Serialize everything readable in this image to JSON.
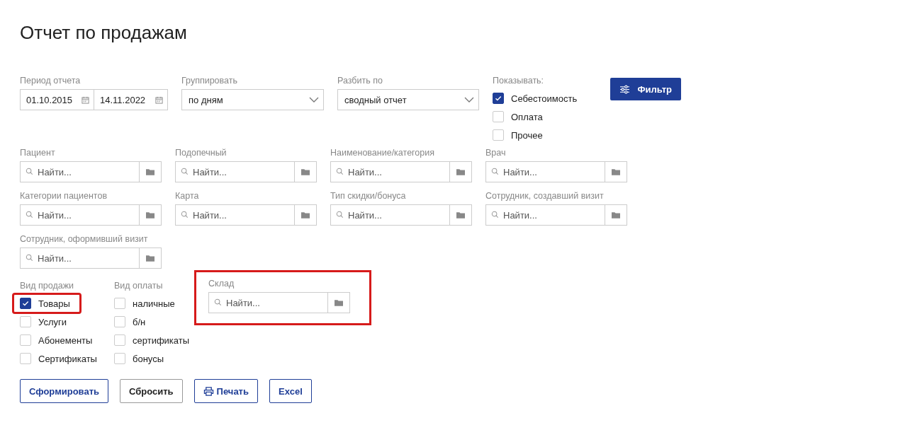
{
  "title": "Отчет по продажам",
  "period": {
    "label": "Период отчета",
    "from": "01.10.2015",
    "to": "14.11.2022"
  },
  "group_by": {
    "label": "Группировать",
    "value": "по дням"
  },
  "split_by": {
    "label": "Разбить по",
    "value": "сводный отчет"
  },
  "show": {
    "label": "Показывать:",
    "options": [
      {
        "label": "Себестоимость",
        "checked": true
      },
      {
        "label": "Оплата",
        "checked": false
      },
      {
        "label": "Прочее",
        "checked": false
      }
    ]
  },
  "filter_button": "Фильтр",
  "lookups": [
    {
      "label": "Пациент",
      "placeholder": "Найти..."
    },
    {
      "label": "Подопечный",
      "placeholder": "Найти..."
    },
    {
      "label": "Наименование/категория",
      "placeholder": "Найти..."
    },
    {
      "label": "Врач",
      "placeholder": "Найти..."
    },
    {
      "label": "Категории пациентов",
      "placeholder": "Найти..."
    },
    {
      "label": "Карта",
      "placeholder": "Найти..."
    },
    {
      "label": "Тип скидки/бонуса",
      "placeholder": "Найти..."
    },
    {
      "label": "Сотрудник, создавший визит",
      "placeholder": "Найти..."
    },
    {
      "label": "Сотрудник, оформивший визит",
      "placeholder": "Найти..."
    }
  ],
  "sale_type": {
    "label": "Вид продажи",
    "options": [
      {
        "label": "Товары",
        "checked": true,
        "highlighted": true
      },
      {
        "label": "Услуги",
        "checked": false,
        "highlighted": false
      },
      {
        "label": "Абонементы",
        "checked": false,
        "highlighted": false
      },
      {
        "label": "Сертификаты",
        "checked": false,
        "highlighted": false
      }
    ]
  },
  "payment_type": {
    "label": "Вид оплаты",
    "options": [
      {
        "label": "наличные",
        "checked": false,
        "highlighted": false
      },
      {
        "label": "б/н",
        "checked": false,
        "highlighted": false
      },
      {
        "label": "сертификаты",
        "checked": false,
        "highlighted": false
      },
      {
        "label": "бонусы",
        "checked": false,
        "highlighted": false
      }
    ]
  },
  "warehouse": {
    "label": "Склад",
    "placeholder": "Найти...",
    "highlighted": true
  },
  "buttons": [
    {
      "label": "Сформировать",
      "kind": "primary"
    },
    {
      "label": "Сбросить",
      "kind": "plain"
    },
    {
      "label": "Печать",
      "kind": "print"
    },
    {
      "label": "Excel",
      "kind": "primary"
    }
  ]
}
